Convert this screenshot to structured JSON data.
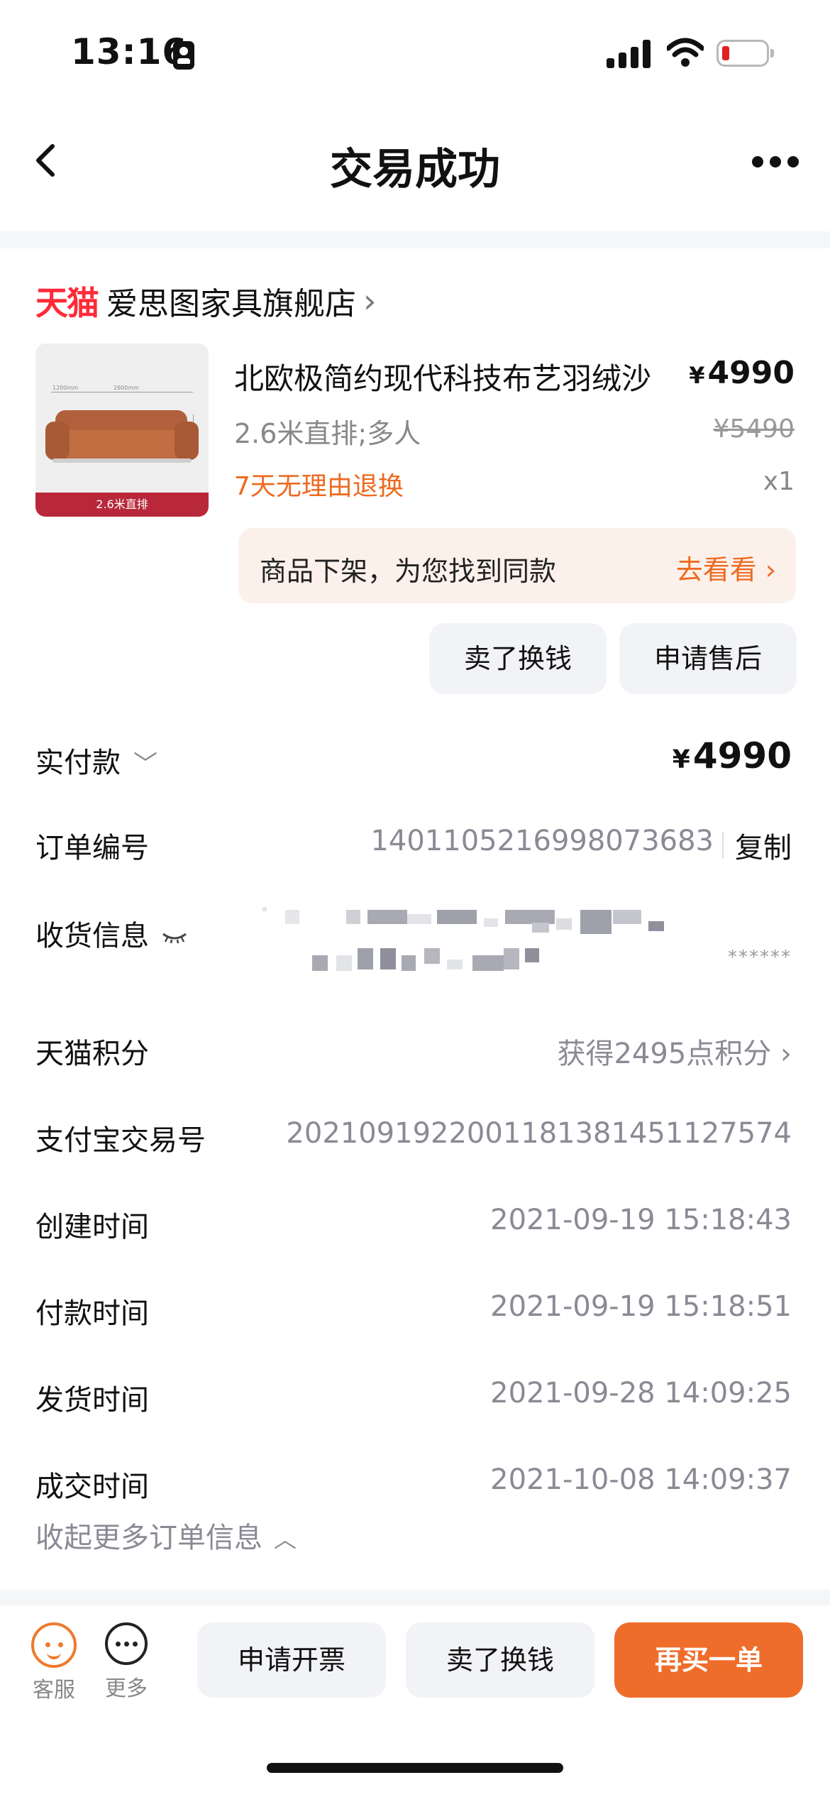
{
  "status_bar": {
    "time": "13:16"
  },
  "nav": {
    "title": "交易成功"
  },
  "store": {
    "logo_text": "天猫",
    "name": "爱思图家具旗舰店"
  },
  "product": {
    "image_tag": "2.6米直排",
    "image_dims": [
      "1200mm",
      "2600mm",
      "800mm"
    ],
    "title": "北欧极简约现代科技布艺羽绒沙",
    "price_symbol": "¥",
    "price": "4990",
    "spec": "2.6米直排;多人",
    "original_price": "¥5490",
    "return_policy": "7天无理由退换",
    "quantity": "x1"
  },
  "similar_banner": {
    "text": "商品下架，为您找到同款",
    "link_label": "去看看"
  },
  "item_actions": {
    "sell": "卖了换钱",
    "after_sale": "申请售后"
  },
  "info": {
    "paid_label": "实付款",
    "paid_symbol": "¥",
    "paid_amount": "4990",
    "order_no_label": "订单编号",
    "order_no": "1401105216998073683",
    "copy_label": "复制",
    "shipping_label": "收货信息",
    "shipping_masked": "******",
    "points_label": "天猫积分",
    "points_value": "获得2495点积分",
    "alipay_label": "支付宝交易号",
    "alipay_no": "2021091922001181381451127574",
    "created_label": "创建时间",
    "created_time": "2021-09-19 15:18:43",
    "paid_time_label": "付款时间",
    "paid_time": "2021-09-19 15:18:51",
    "shipped_label": "发货时间",
    "shipped_time": "2021-09-28 14:09:25",
    "closed_label": "成交时间",
    "closed_time": "2021-10-08 14:09:37",
    "collapse_label": "收起更多订单信息"
  },
  "bottom_bar": {
    "customer_service": "客服",
    "more": "更多",
    "invoice": "申请开票",
    "sell": "卖了换钱",
    "rebuy": "再买一单"
  },
  "colors": {
    "accent": "#ef6d2a",
    "tmall_red": "#ff2a38",
    "return_orange": "#ee6a20",
    "banner_bg": "#fcf1ea"
  }
}
